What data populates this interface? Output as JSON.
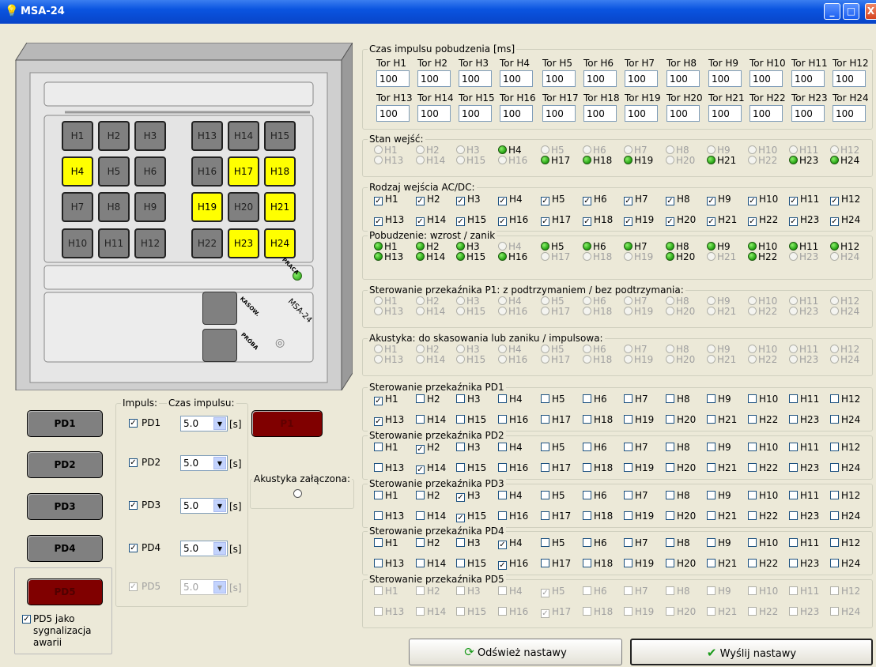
{
  "window": {
    "title": "MSA-24",
    "min": "_",
    "max": "□",
    "close": "X"
  },
  "device": {
    "rows": [
      [
        "H1",
        "H2",
        "H3",
        "H13",
        "H14",
        "H15"
      ],
      [
        "H4",
        "H5",
        "H6",
        "H16",
        "H17",
        "H18"
      ],
      [
        "H7",
        "H8",
        "H9",
        "H19",
        "H20",
        "H21"
      ],
      [
        "H10",
        "H11",
        "H12",
        "H22",
        "H23",
        "H24"
      ]
    ],
    "lit": [
      "H4",
      "H17",
      "H18",
      "H19",
      "H21",
      "H23",
      "H24"
    ],
    "praca": "PRACA",
    "kasow": "KASOW.",
    "proba": "PRÓBA",
    "model": "MSA-24"
  },
  "left": {
    "pd_buttons": [
      "PD1",
      "PD2",
      "PD3",
      "PD4",
      "PD5"
    ],
    "impuls_legend": "Impuls:",
    "czas_legend": "Czas impulsu:",
    "impuls_items": [
      {
        "label": "PD1",
        "value": "5.0",
        "checked": true,
        "enabled": true
      },
      {
        "label": "PD2",
        "value": "5.0",
        "checked": true,
        "enabled": true
      },
      {
        "label": "PD3",
        "value": "5.0",
        "checked": true,
        "enabled": true
      },
      {
        "label": "PD4",
        "value": "5.0",
        "checked": true,
        "enabled": true
      },
      {
        "label": "PD5",
        "value": "5.0",
        "checked": true,
        "enabled": false
      }
    ],
    "unit": "[s]",
    "p1": "P1",
    "akustyka": "Akustyka załączona:",
    "pd5_check": "PD5 jako",
    "pd5_line2": "sygnalizacja",
    "pd5_line3": "awarii"
  },
  "czas": {
    "legend": "Czas impulsu pobudzenia [ms]",
    "labels1": [
      "Tor H1",
      "Tor H2",
      "Tor H3",
      "Tor H4",
      "Tor H5",
      "Tor H6",
      "Tor H7",
      "Tor H8",
      "Tor H9",
      "Tor H10",
      "Tor H11",
      "Tor H12"
    ],
    "labels2": [
      "Tor H13",
      "Tor H14",
      "Tor H15",
      "Tor H16",
      "Tor H17",
      "Tor H18",
      "Tor H19",
      "Tor H20",
      "Tor H21",
      "Tor H22",
      "Tor H23",
      "Tor H24"
    ],
    "values": [
      "100",
      "100",
      "100",
      "100",
      "100",
      "100",
      "100",
      "100",
      "100",
      "100",
      "100",
      "100",
      "100",
      "100",
      "100",
      "100",
      "100",
      "100",
      "100",
      "100",
      "100",
      "100",
      "100",
      "100"
    ]
  },
  "sections": [
    {
      "legend": "Stan wejść:",
      "kind": "dot",
      "on": [
        4,
        17,
        18,
        19,
        21,
        23,
        24
      ]
    },
    {
      "legend": "Rodzaj wejścia AC/DC:",
      "kind": "check",
      "on": [
        1,
        2,
        3,
        4,
        5,
        6,
        7,
        8,
        9,
        10,
        11,
        12,
        13,
        14,
        15,
        16,
        17,
        18,
        19,
        20,
        21,
        22,
        23,
        24
      ]
    },
    {
      "legend": "Pobudzenie:  wzrost / zanik",
      "kind": "dot",
      "on": [
        1,
        2,
        3,
        5,
        6,
        7,
        8,
        9,
        10,
        11,
        12,
        13,
        14,
        15,
        16,
        20,
        22
      ]
    },
    {
      "legend": "Sterowanie przekaźnika P1:  z podtrzymaniem / bez podtrzymania:",
      "kind": "dot",
      "on": []
    },
    {
      "legend": "Akustyka: do skasowania lub zaniku / impulsowa:",
      "kind": "dot",
      "on": []
    },
    {
      "legend": "Sterowanie przekaźnika PD1",
      "kind": "check",
      "on": [
        1,
        13
      ]
    },
    {
      "legend": "Sterowanie przekaźnika PD2",
      "kind": "check",
      "on": [
        2,
        14
      ]
    },
    {
      "legend": "Sterowanie przekaźnika PD3",
      "kind": "check",
      "on": [
        3,
        15
      ]
    },
    {
      "legend": "Sterowanie przekaźnika PD4",
      "kind": "check",
      "on": [
        4,
        16
      ]
    },
    {
      "legend": "Sterowanie przekaźnika PD5",
      "kind": "check",
      "on": [
        5,
        17
      ],
      "disabled": true
    }
  ],
  "channels": [
    "H1",
    "H2",
    "H3",
    "H4",
    "H5",
    "H6",
    "H7",
    "H8",
    "H9",
    "H10",
    "H11",
    "H12",
    "H13",
    "H14",
    "H15",
    "H16",
    "H17",
    "H18",
    "H19",
    "H20",
    "H21",
    "H22",
    "H23",
    "H24"
  ],
  "buttons": {
    "refresh": "Odśwież nastawy",
    "send": "Wyślij nastawy"
  },
  "colors": {
    "lit": "#ffff00",
    "off": "#808080",
    "green": "#21a010",
    "red": "#800000"
  }
}
